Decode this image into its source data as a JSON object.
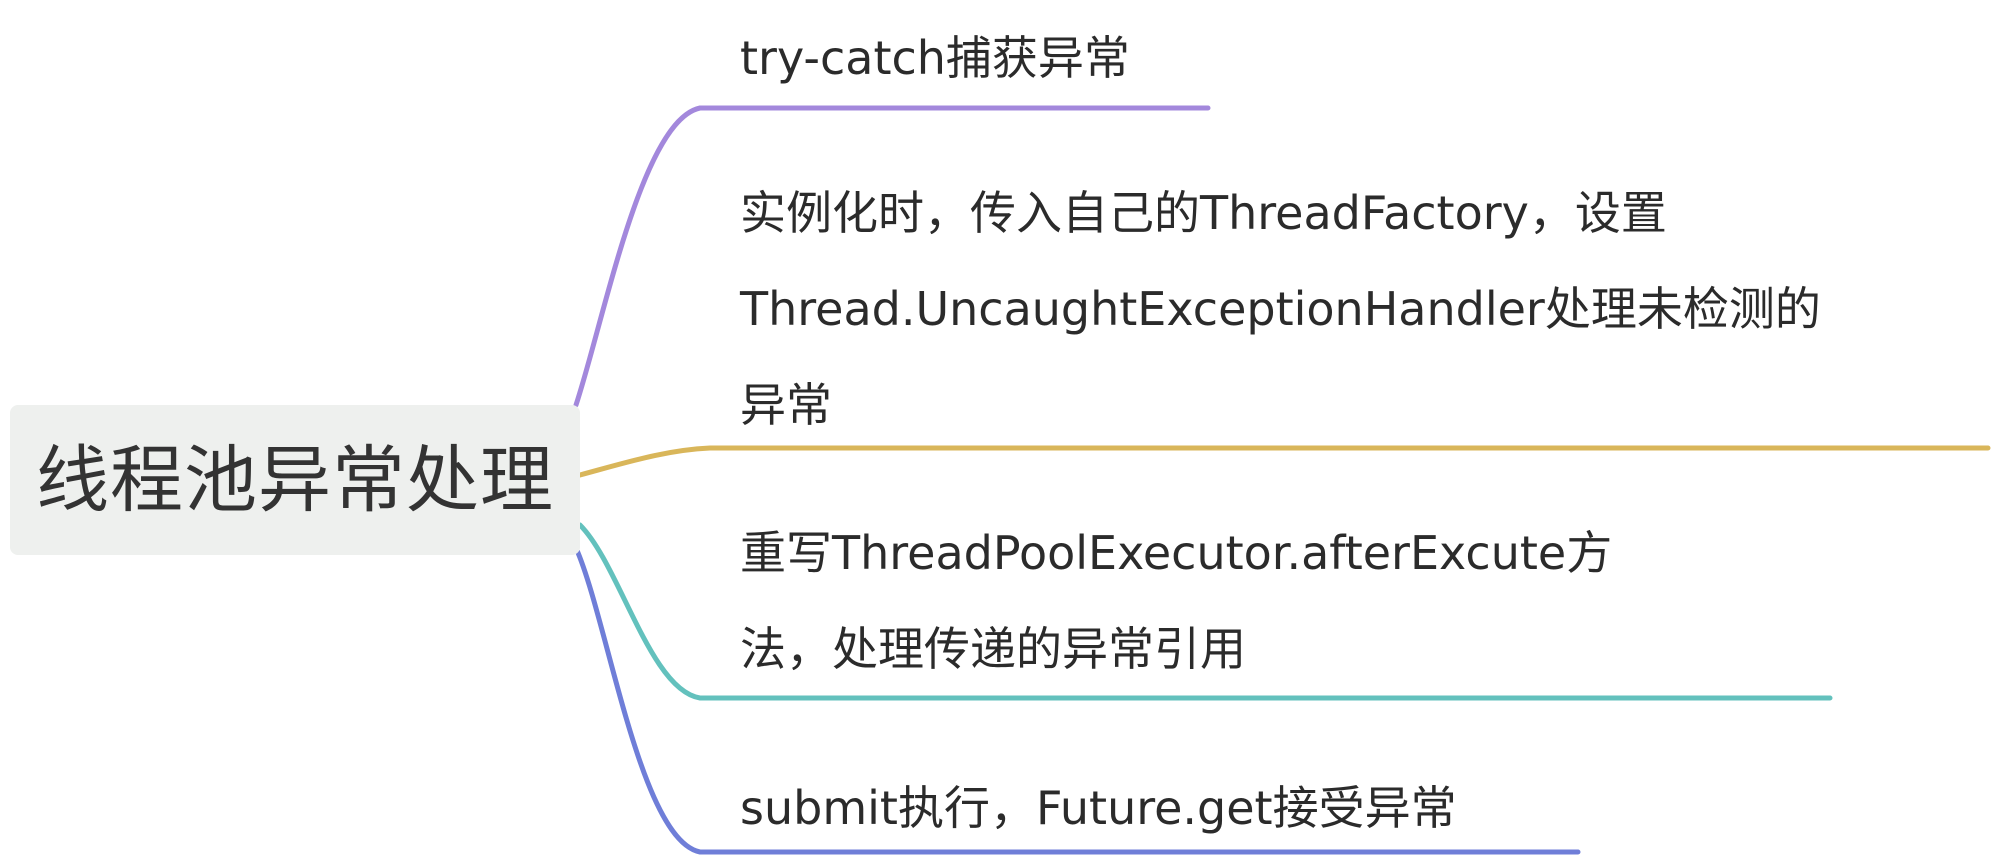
{
  "root": {
    "label": "线程池异常处理",
    "fill": "#eef0ee"
  },
  "branches": [
    {
      "lines": [
        "try-catch捕获异常"
      ],
      "color": "#a388dc"
    },
    {
      "lines": [
        "实例化时，传入自己的ThreadFactory，设置",
        "Thread.UncaughtExceptionHandler处理未检测的",
        "异常"
      ],
      "color": "#d9b65a"
    },
    {
      "lines": [
        "重写ThreadPoolExecutor.afterExcute方",
        "法，处理传递的异常引用"
      ],
      "color": "#63c1bd"
    },
    {
      "lines": [
        "submit执行，Future.get接受异常"
      ],
      "color": "#6f7ed8"
    }
  ]
}
